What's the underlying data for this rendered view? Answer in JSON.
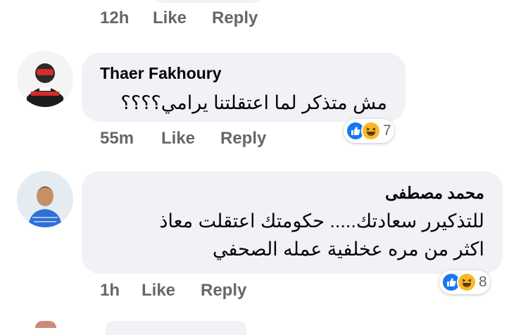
{
  "top_comment": {
    "time": "12h",
    "like_label": "Like",
    "reply_label": "Reply"
  },
  "comment1": {
    "author": "Thaer Fakhoury",
    "text": "مش متذكر لما اعتقلتنا يرامي؟؟؟؟",
    "time": "55m",
    "like_label": "Like",
    "reply_label": "Reply",
    "reactions": {
      "icons": [
        "like-icon",
        "haha-icon"
      ],
      "count": "7"
    }
  },
  "comment2": {
    "author": "محمد مصطفى",
    "lines": [
      "للتذكيرر سعادتك..... حكومتك اعتقلت معاذ",
      "اكثر من مره عخلفية عمله الصحفي"
    ],
    "time": "1h",
    "like_label": "Like",
    "reply_label": "Reply",
    "reactions": {
      "icons": [
        "like-icon",
        "haha-icon"
      ],
      "count": "8"
    }
  },
  "colors": {
    "like_blue": "#1877f2",
    "haha_yellow": "#f7b928",
    "bubble_gray": "#f0f2f5",
    "meta_gray": "#65676b"
  }
}
